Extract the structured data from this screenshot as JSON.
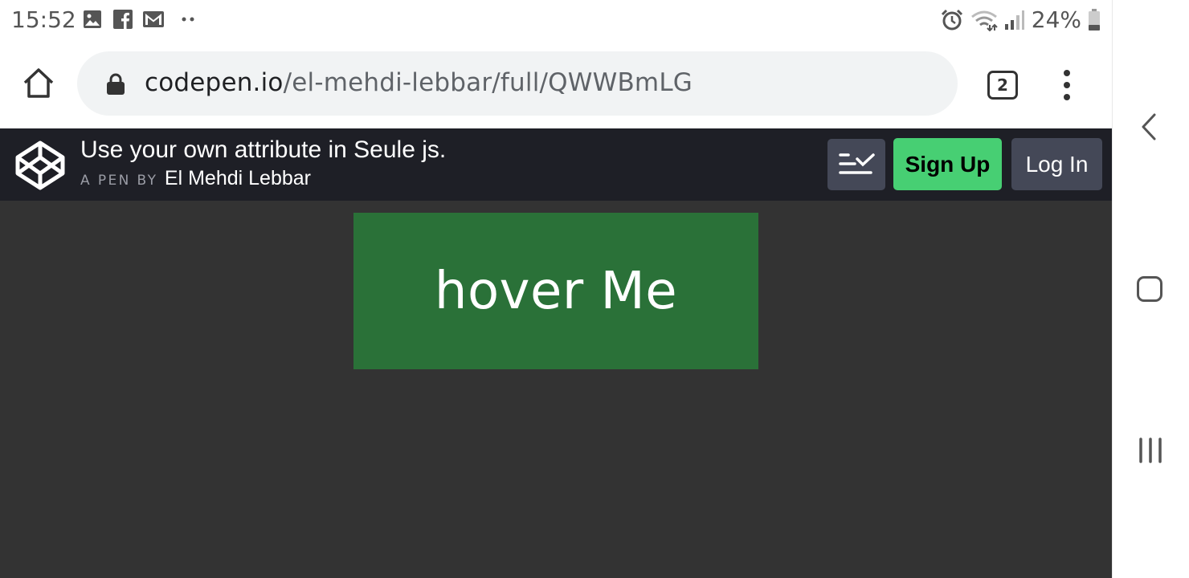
{
  "status_bar": {
    "time": "15:52",
    "notification_icons": [
      "image-icon",
      "facebook-icon",
      "gmail-icon",
      "more-dots-icon"
    ],
    "system_icons": [
      "alarm-icon",
      "wifi-icon",
      "signal-icon",
      "battery-icon"
    ],
    "battery": "24%"
  },
  "browser": {
    "url_host": "codepen.io",
    "url_path": "/el-mehdi-lebbar/full/QWWBmLG",
    "tab_count": "2"
  },
  "codepen": {
    "title": "Use your own attribute in Seule js.",
    "pen_by": "A PEN BY",
    "author": "El Mehdi Lebbar",
    "signup_label": "Sign Up",
    "login_label": "Log In",
    "colors": {
      "header_bg": "#1e1f26",
      "signup_bg": "#47cf73",
      "button_bg": "#444857"
    }
  },
  "pen": {
    "box_text": "hover Me",
    "colors": {
      "page_bg": "#333333",
      "box_bg": "#2a7138"
    }
  },
  "nav_bar": {
    "buttons": [
      "back-icon",
      "home-icon",
      "recent-apps-icon"
    ]
  }
}
